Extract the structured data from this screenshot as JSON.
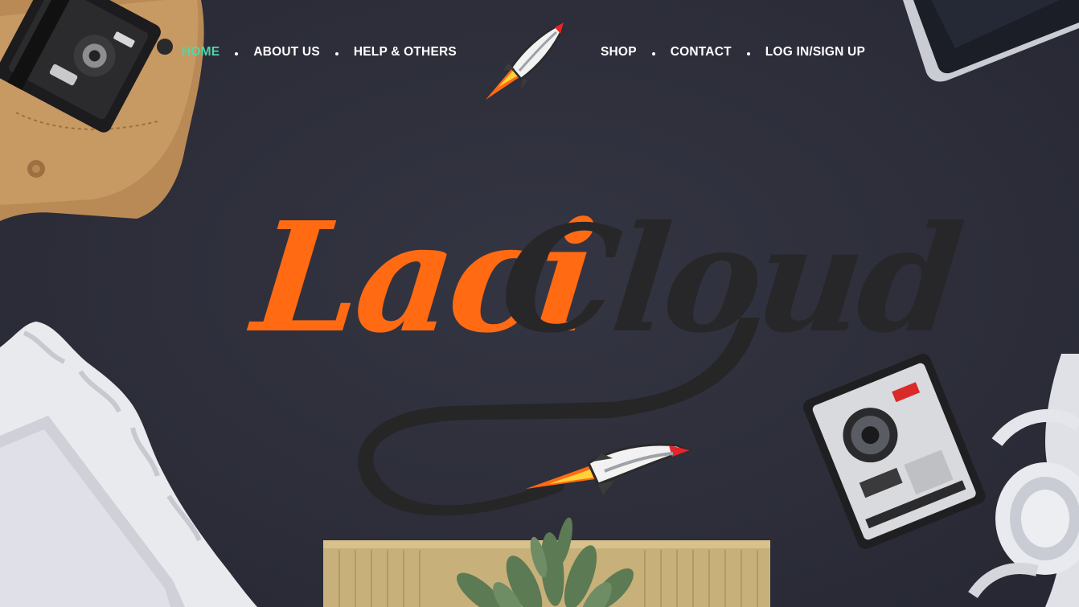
{
  "nav": {
    "left_items": [
      {
        "label": "HOME",
        "active": true
      },
      {
        "label": "ABOUT US",
        "active": false
      },
      {
        "label": "HELP & OTHERS",
        "active": false
      }
    ],
    "right_items": [
      {
        "label": "SHOP",
        "active": false
      },
      {
        "label": "CONTACT",
        "active": false
      },
      {
        "label": "LOG IN/SIGN UP",
        "active": false
      }
    ],
    "logo_icon": "rocket-icon"
  },
  "brand": {
    "part1": "Laci",
    "part2": "Cloud",
    "emblem_icon": "rocket-icon"
  },
  "colors": {
    "background": "#2d2e3a",
    "nav_text": "#ffffff",
    "nav_active": "#4fd6a8",
    "brand_orange": "#ff6a13",
    "brand_dark": "#272729"
  }
}
